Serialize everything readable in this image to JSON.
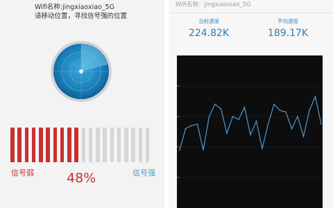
{
  "left_panel": {
    "wifi_name": "Wifi名称:jingxiaoxiao_5G",
    "instruction": "请移动位置，寻找信号强的位置",
    "signal_percent": 48,
    "signal_percent_text": "48%",
    "weak_label": "信号弱",
    "strong_label": "信号强",
    "bar_total": 20,
    "bar_filled": 10
  },
  "right_panel": {
    "title": "Wifi名称：jingxiaoxiao_5G",
    "current_speed_label": "当前速度",
    "current_speed_value": "224.82K",
    "average_speed_label": "平均速度",
    "average_speed_value": "189.17K"
  },
  "colors": {
    "signal_red": "#c8312f",
    "signal_blue": "#3f9fcf",
    "chart_bg": "#0d0d0d",
    "chart_line": "#4a90c8",
    "bar_inactive": "#d6d6d6"
  },
  "chart_data": {
    "type": "line",
    "title": "",
    "xlabel": "",
    "ylabel": "",
    "ylim": [
      0,
      100
    ],
    "series": [
      {
        "values": [
          38,
          52,
          54,
          55,
          38,
          60,
          68,
          65,
          49,
          60,
          58,
          66,
          48,
          57,
          39,
          55,
          68,
          64,
          63,
          52,
          60,
          47,
          64,
          73,
          55
        ]
      }
    ]
  }
}
